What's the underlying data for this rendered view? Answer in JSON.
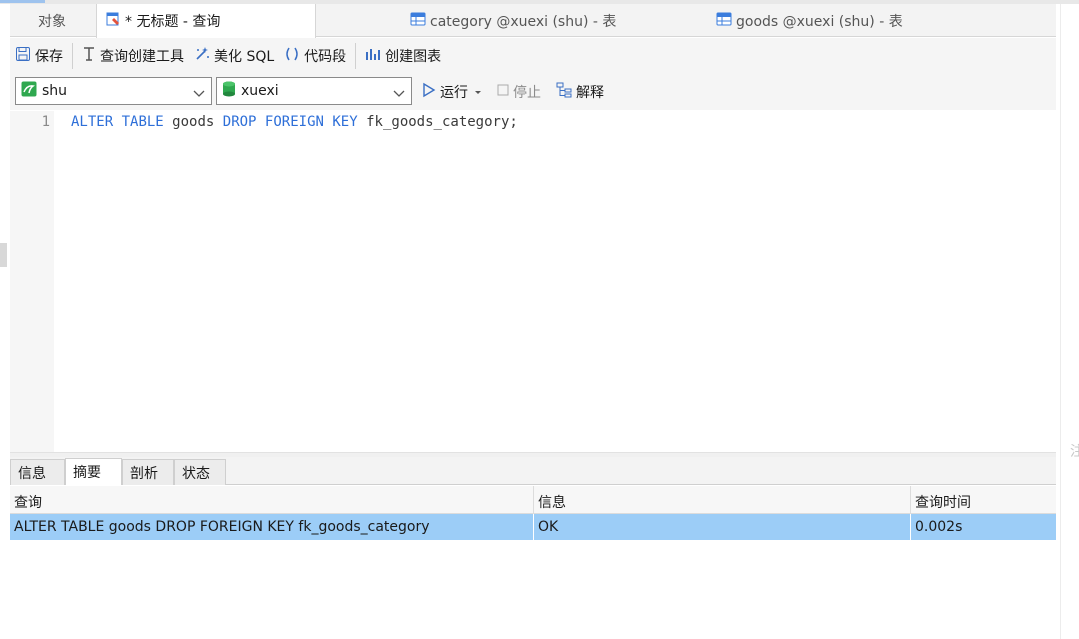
{
  "tabs": [
    {
      "label": "对象",
      "icon": "object-list-icon"
    },
    {
      "label": "* 无标题 - 查询",
      "icon": "query-icon"
    },
    {
      "label": "category @xuexi (shu) - 表",
      "icon": "table-icon"
    },
    {
      "label": "goods @xuexi (shu) - 表",
      "icon": "table-icon"
    }
  ],
  "toolbar": {
    "save": "保存",
    "query_builder": "查询创建工具",
    "beautify": "美化 SQL",
    "snippet": "代码段",
    "create_chart": "创建图表"
  },
  "connection": {
    "selected": "shu"
  },
  "database": {
    "selected": "xuexi"
  },
  "run_bar": {
    "run": "运行",
    "stop": "停止",
    "explain": "解释"
  },
  "editor": {
    "line_number": "1",
    "tokens": [
      {
        "text": "ALTER",
        "kind": "kw"
      },
      {
        "text": " ",
        "kind": "id"
      },
      {
        "text": "TABLE",
        "kind": "kw"
      },
      {
        "text": " goods ",
        "kind": "id"
      },
      {
        "text": "DROP",
        "kind": "kw"
      },
      {
        "text": " ",
        "kind": "id"
      },
      {
        "text": "FOREIGN",
        "kind": "kw"
      },
      {
        "text": " ",
        "kind": "id"
      },
      {
        "text": "KEY",
        "kind": "kw"
      },
      {
        "text": " fk_goods_category;",
        "kind": "id"
      }
    ]
  },
  "result_tabs": [
    {
      "label": "信息"
    },
    {
      "label": "摘要"
    },
    {
      "label": "剖析"
    },
    {
      "label": "状态"
    }
  ],
  "result_table": {
    "headers": [
      "查询",
      "信息",
      "查询时间"
    ],
    "rows": [
      [
        "ALTER TABLE goods DROP FOREIGN KEY fk_goods_category",
        "OK",
        "0.002s"
      ]
    ]
  },
  "side_glyph": "注",
  "colors": {
    "accent": "#2e6fd8",
    "selected_row": "#9ccdf7"
  }
}
